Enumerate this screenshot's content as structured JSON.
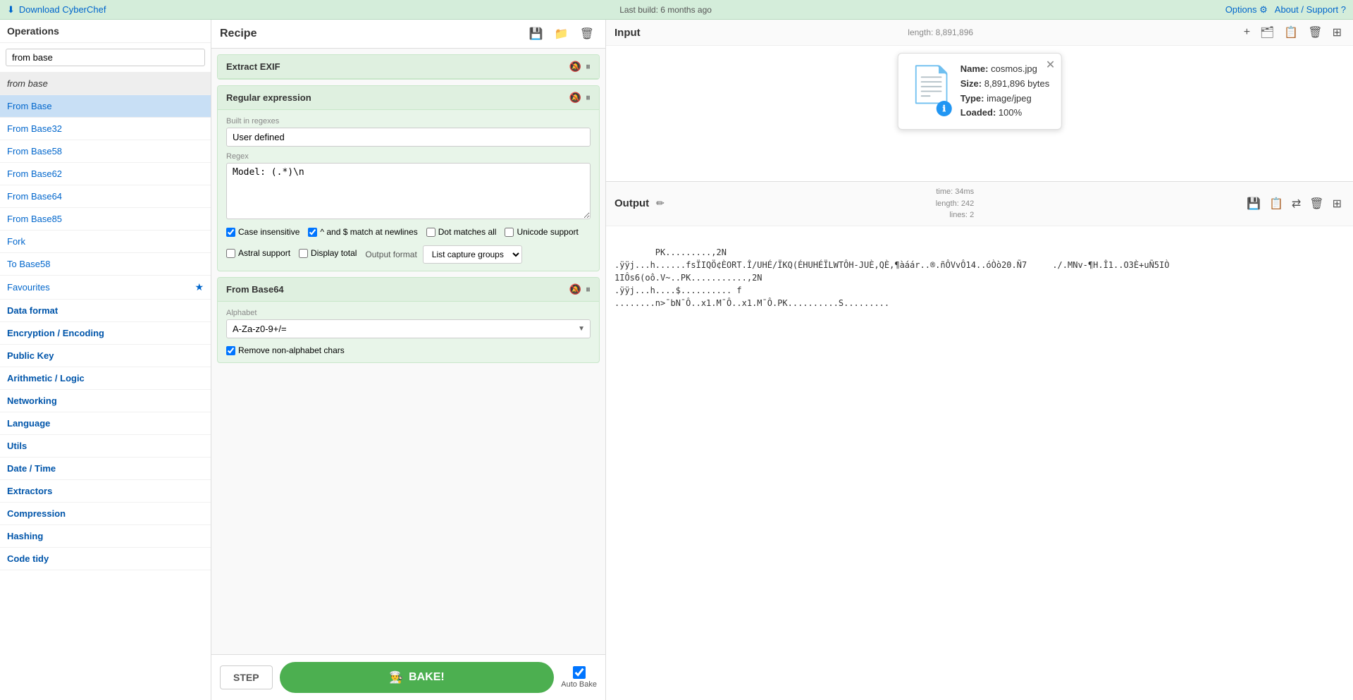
{
  "topbar": {
    "download_label": "Download CyberChef",
    "download_icon": "⬇",
    "build_info": "Last build: 6 months ago",
    "options_label": "Options",
    "about_label": "About / Support",
    "gear_icon": "⚙",
    "help_icon": "?"
  },
  "sidebar": {
    "search_placeholder": "from base",
    "ops_label": "Operations",
    "items": [
      {
        "label": "from base",
        "type": "search-result",
        "active": false
      },
      {
        "label": "From Base",
        "type": "item",
        "active": true
      },
      {
        "label": "From Base32",
        "type": "item",
        "active": false
      },
      {
        "label": "From Base58",
        "type": "item",
        "active": false
      },
      {
        "label": "From Base62",
        "type": "item",
        "active": false
      },
      {
        "label": "From Base64",
        "type": "item",
        "active": false
      },
      {
        "label": "From Base85",
        "type": "item",
        "active": false
      },
      {
        "label": "Fork",
        "type": "item",
        "active": false
      },
      {
        "label": "To Base58",
        "type": "item",
        "active": false
      },
      {
        "label": "Favourites",
        "type": "section",
        "active": false
      },
      {
        "label": "Data format",
        "type": "section",
        "active": false
      },
      {
        "label": "Encryption / Encoding",
        "type": "section",
        "active": false
      },
      {
        "label": "Public Key",
        "type": "section",
        "active": false
      },
      {
        "label": "Arithmetic / Logic",
        "type": "section",
        "active": false
      },
      {
        "label": "Networking",
        "type": "section",
        "active": false
      },
      {
        "label": "Language",
        "type": "section",
        "active": false
      },
      {
        "label": "Utils",
        "type": "section",
        "active": false
      },
      {
        "label": "Date / Time",
        "type": "section",
        "active": false
      },
      {
        "label": "Extractors",
        "type": "section",
        "active": false
      },
      {
        "label": "Compression",
        "type": "section",
        "active": false
      },
      {
        "label": "Hashing",
        "type": "section",
        "active": false
      },
      {
        "label": "Code tidy",
        "type": "section",
        "active": false
      }
    ]
  },
  "recipe": {
    "title": "Recipe",
    "save_icon": "💾",
    "folder_icon": "📁",
    "delete_icon": "🗑",
    "steps": [
      {
        "id": "extract-exif",
        "title": "Extract EXIF",
        "fields": []
      },
      {
        "id": "regular-expression",
        "title": "Regular expression",
        "fields": [
          {
            "label": "Built in regexes",
            "type": "text",
            "value": "User defined"
          },
          {
            "label": "Regex",
            "type": "textarea",
            "value": "Model: (.*)\n"
          }
        ],
        "checkboxes": [
          {
            "label": "Case insensitive",
            "checked": true
          },
          {
            "label": "^ and $ match at newlines",
            "checked": true
          },
          {
            "label": "Dot matches all",
            "checked": false
          },
          {
            "label": "Unicode support",
            "checked": false
          },
          {
            "label": "Astral support",
            "checked": false
          },
          {
            "label": "Display total",
            "checked": false
          }
        ],
        "output_format_label": "Output format",
        "output_format_value": "List capture groups"
      },
      {
        "id": "from-base64",
        "title": "From Base64",
        "fields": [
          {
            "label": "Alphabet",
            "type": "select",
            "value": "A-Za-z0-9+/="
          }
        ],
        "checkboxes": [
          {
            "label": "Remove non-alphabet chars",
            "checked": true
          }
        ]
      }
    ],
    "step_label": "STEP",
    "bake_label": "BAKE!",
    "bake_chef_icon": "👨‍🍳",
    "auto_bake_label": "Auto Bake",
    "auto_bake_checked": true
  },
  "input": {
    "title": "Input",
    "length_label": "length:",
    "length_value": "8,891,896",
    "file": {
      "name_label": "Name:",
      "name_value": "cosmos.jpg",
      "size_label": "Size:",
      "size_value": "8,891,896 bytes",
      "type_label": "Type:",
      "type_value": "image/jpeg",
      "loaded_label": "Loaded:",
      "loaded_value": "100%"
    }
  },
  "output": {
    "title": "Output",
    "time_label": "time:",
    "time_value": "34ms",
    "length_label": "length:",
    "length_value": "242",
    "lines_label": "lines:",
    "lines_value": "2",
    "content": "PK.........,2N\n.ÿÿj...h......fsÏIQÖ¢ÈORT.Î/UHÉ/ÏKQ(ÉHUHÉÏLWTÔH-JUÈ,QÈ,¶àáár..®.ñÔVvÔ14..óÒò20.Ñ7     ./.MNv-¶H.Î1..O3È+uÑ5IÒ\n1IÔs6(oô.V~..PK...........,2N\n.ÿÿj...h....$.......... f\n........n>¯bN¯Ô..x1.M¯Ô..x1.M¯Ô.PK..........S........."
  }
}
